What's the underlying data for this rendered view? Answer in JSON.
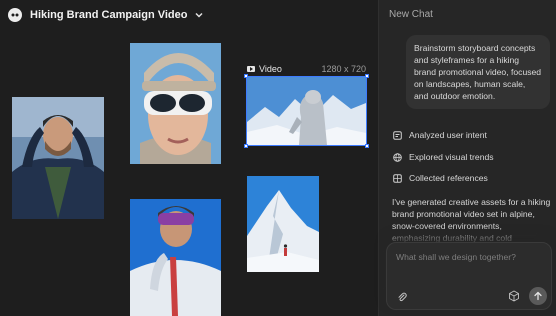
{
  "project": {
    "title": "Hiking Brand Campaign Video"
  },
  "canvas": {
    "video_label": "Video",
    "video_dimensions": "1280 x 720",
    "images": [
      {
        "name": "bearded-man-portrait"
      },
      {
        "name": "woman-goggles-portrait"
      },
      {
        "name": "hiker-snow-video"
      },
      {
        "name": "climber-goggles-portrait"
      },
      {
        "name": "mountain-summit-climber"
      }
    ]
  },
  "chat": {
    "panel_title": "New Chat",
    "user_message": "Brainstorm storyboard concepts and styleframes for a hiking brand promotional video, focused on landscapes, human scale, and outdoor emotion.",
    "steps": [
      {
        "label": "Analyzed user intent",
        "icon": "doc-icon"
      },
      {
        "label": "Explored visual trends",
        "icon": "globe-icon"
      },
      {
        "label": "Collected references",
        "icon": "grid-icon"
      }
    ],
    "assistant_reply": "I've generated creative assets for a hiking brand promotional video set in alpine, snow-covered environments, emphasizing durability and cold",
    "composer_placeholder": "What shall we design together?"
  }
}
